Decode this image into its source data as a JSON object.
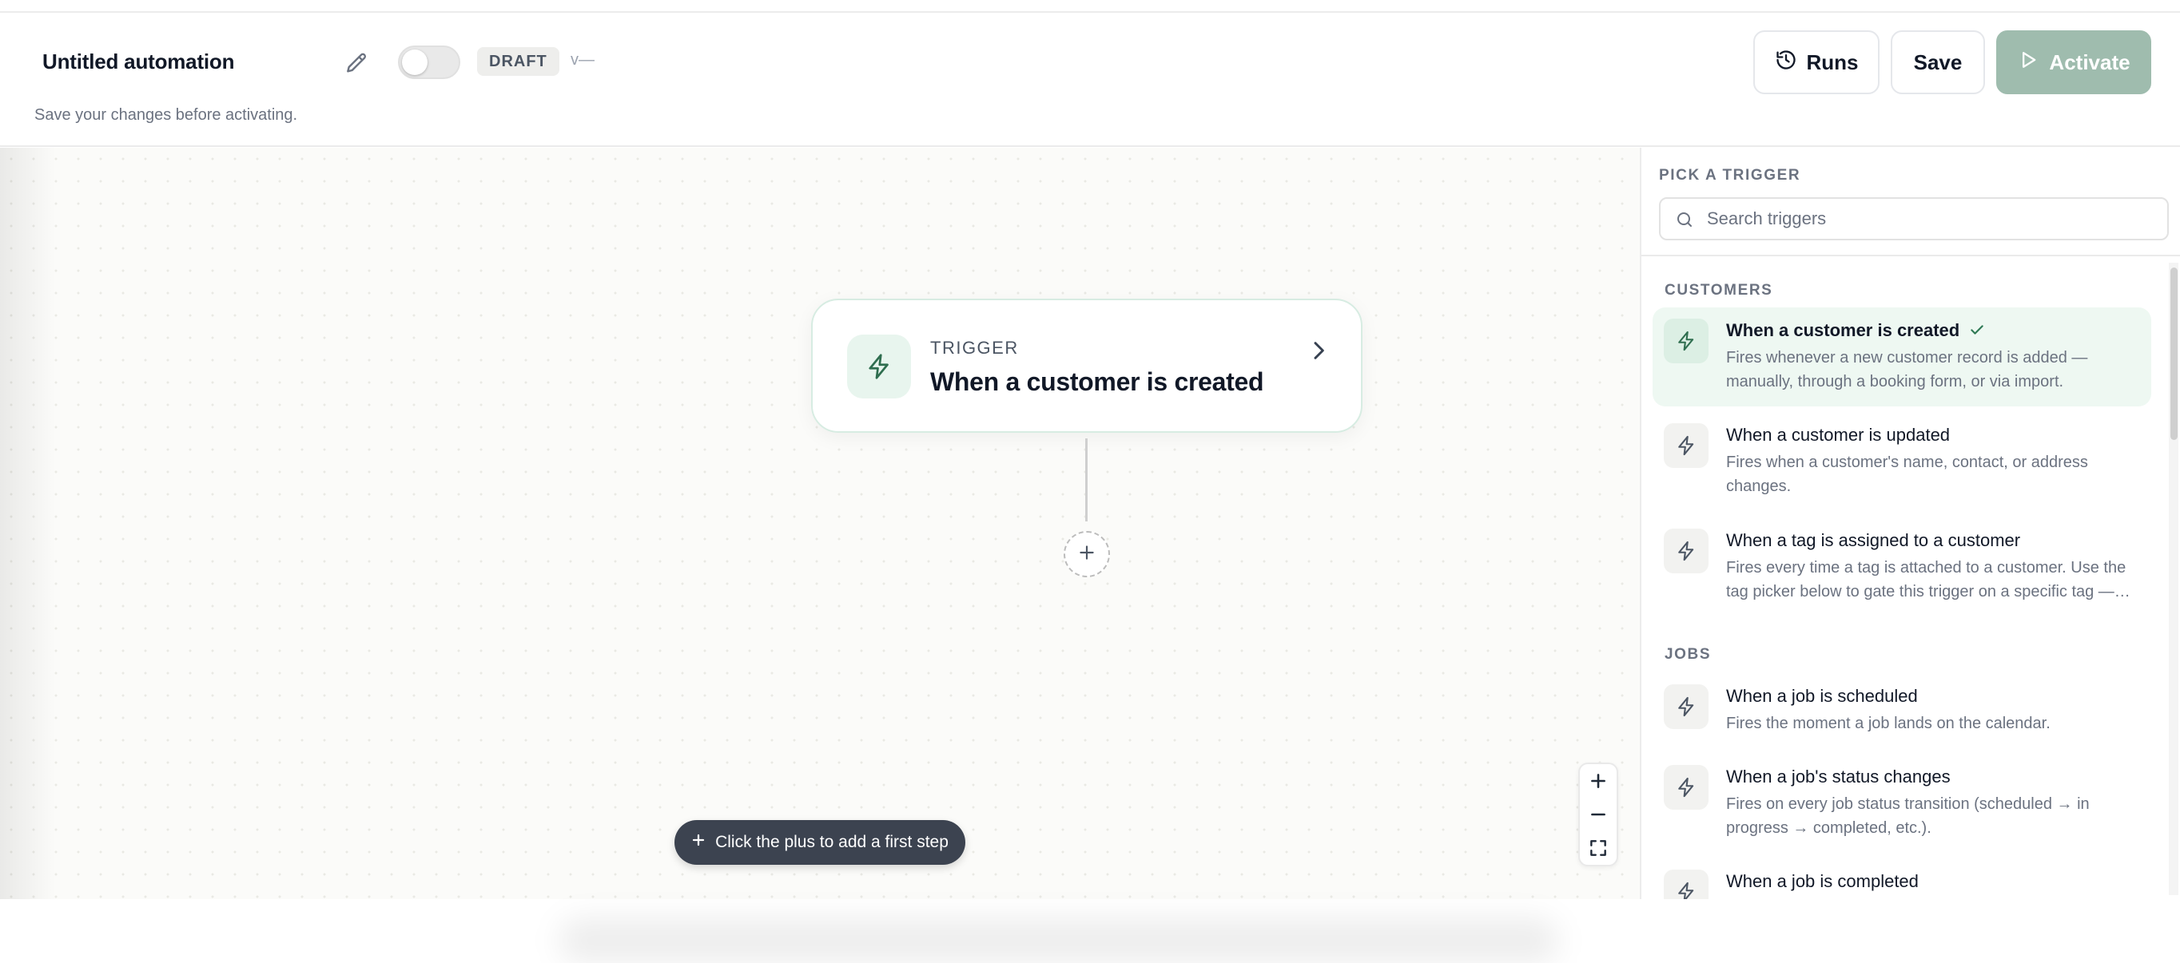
{
  "header": {
    "title": "Untitled automation",
    "status_badge": "DRAFT",
    "version": "v—",
    "subtitle": "Save your changes before activating.",
    "runs_label": "Runs",
    "save_label": "Save",
    "activate_label": "Activate",
    "activation_toggle_on": false
  },
  "canvas": {
    "trigger_card": {
      "kicker": "TRIGGER",
      "name": "When a customer is created"
    },
    "hint": "Click the plus to add a first step"
  },
  "panel": {
    "heading": "PICK A TRIGGER",
    "search_placeholder": "Search triggers",
    "groups": [
      {
        "label": "CUSTOMERS",
        "items": [
          {
            "title": "When a customer is created",
            "desc": "Fires whenever a new customer record is added — manually, through a booking form, or via import.",
            "selected": true
          },
          {
            "title": "When a customer is updated",
            "desc": "Fires when a customer's name, contact, or address changes.",
            "selected": false
          },
          {
            "title": "When a tag is assigned to a customer",
            "desc": "Fires every time a tag is attached to a customer. Use the tag picker below to gate this trigger on a specific tag —…",
            "selected": false
          }
        ]
      },
      {
        "label": "JOBS",
        "items": [
          {
            "title": "When a job is scheduled",
            "desc": "Fires the moment a job lands on the calendar.",
            "selected": false
          },
          {
            "title": "When a job's status changes",
            "desc": "Fires on every job status transition (scheduled → in progress → completed, etc.).",
            "selected": false
          },
          {
            "title": "When a job is completed",
            "desc": "",
            "selected": false
          }
        ]
      }
    ]
  },
  "colors": {
    "accent_green": "#2f6e4f",
    "activate_disabled": "#9fbcae",
    "hint_bg": "#3c4350"
  },
  "icons": [
    "pencil-icon",
    "history-icon",
    "play-icon",
    "lightning-icon",
    "chevron-right-icon",
    "plus-icon",
    "minus-icon",
    "fullscreen-icon",
    "search-icon",
    "check-icon"
  ]
}
